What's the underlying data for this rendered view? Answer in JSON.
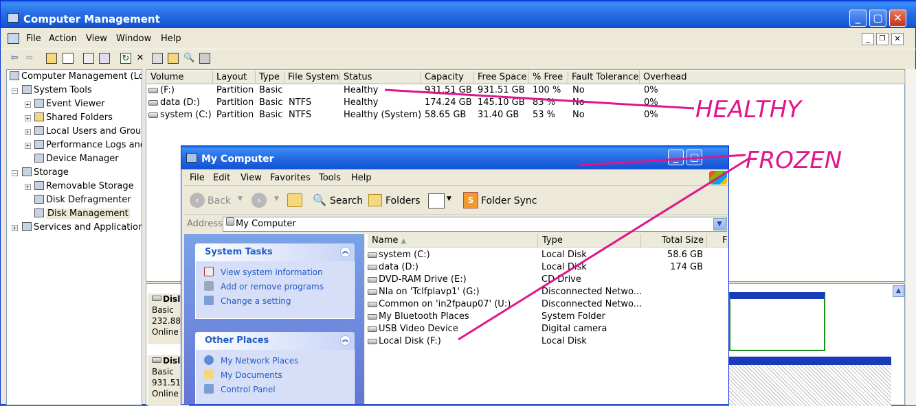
{
  "cm": {
    "title": "Computer Management",
    "menu": [
      "File",
      "Action",
      "View",
      "Window",
      "Help"
    ],
    "tree": [
      {
        "label": "Computer Management (Loc",
        "level": 0
      },
      {
        "label": "System Tools",
        "level": 1
      },
      {
        "label": "Event Viewer",
        "level": 2
      },
      {
        "label": "Shared Folders",
        "level": 2
      },
      {
        "label": "Local Users and Group",
        "level": 2
      },
      {
        "label": "Performance Logs and",
        "level": 2
      },
      {
        "label": "Device Manager",
        "level": 2
      },
      {
        "label": "Storage",
        "level": 1
      },
      {
        "label": "Removable Storage",
        "level": 2
      },
      {
        "label": "Disk Defragmenter",
        "level": 2
      },
      {
        "label": "Disk Management",
        "level": 2
      },
      {
        "label": "Services and Applications",
        "level": 1
      }
    ],
    "volume_headers": [
      "Volume",
      "Layout",
      "Type",
      "File System",
      "Status",
      "Capacity",
      "Free Space",
      "% Free",
      "Fault Tolerance",
      "Overhead"
    ],
    "volumes": [
      [
        "(F:)",
        "Partition",
        "Basic",
        "",
        "Healthy",
        "931.51 GB",
        "931.51 GB",
        "100 %",
        "No",
        "0%"
      ],
      [
        "data (D:)",
        "Partition",
        "Basic",
        "NTFS",
        "Healthy",
        "174.24 GB",
        "145.10 GB",
        "83 %",
        "No",
        "0%"
      ],
      [
        "system (C:)",
        "Partition",
        "Basic",
        "NTFS",
        "Healthy (System)",
        "58.65 GB",
        "31.40 GB",
        "53 %",
        "No",
        "0%"
      ]
    ],
    "disks": [
      {
        "name": "Disl",
        "type": "Basic",
        "size": "232.88",
        "state": "Online"
      },
      {
        "name": "Disl",
        "type": "Basic",
        "size": "931.51",
        "state": "Online"
      }
    ]
  },
  "mc": {
    "title": "My Computer",
    "menu": [
      "File",
      "Edit",
      "View",
      "Favorites",
      "Tools",
      "Help"
    ],
    "toolbar": {
      "back": "Back",
      "search": "Search",
      "folders": "Folders",
      "folder_sync": "Folder Sync"
    },
    "address_label": "Address",
    "address_value": "My Computer",
    "system_tasks": {
      "title": "System Tasks",
      "links": [
        "View system information",
        "Add or remove programs",
        "Change a setting"
      ]
    },
    "other_places": {
      "title": "Other Places",
      "links": [
        "My Network Places",
        "My Documents",
        "Control Panel"
      ]
    },
    "file_headers": [
      "Name",
      "Type",
      "Total Size",
      "F"
    ],
    "files": [
      {
        "name": "system (C:)",
        "type": "Local Disk",
        "size": "58.6 GB"
      },
      {
        "name": "data (D:)",
        "type": "Local Disk",
        "size": "174 GB"
      },
      {
        "name": "DVD-RAM Drive (E:)",
        "type": "CD Drive",
        "size": ""
      },
      {
        "name": "Nla on 'Tclfplavp1' (G:)",
        "type": "Disconnected Netwo...",
        "size": ""
      },
      {
        "name": "Common on 'in2fpaup07' (U:)",
        "type": "Disconnected Netwo...",
        "size": ""
      },
      {
        "name": "My Bluetooth Places",
        "type": "System Folder",
        "size": ""
      },
      {
        "name": "USB Video Device",
        "type": "Digital camera",
        "size": ""
      },
      {
        "name": "Local Disk (F:)",
        "type": "Local Disk",
        "size": ""
      }
    ]
  },
  "annotations": {
    "healthy": "HEALTHY",
    "frozen": "FROZEN"
  },
  "colors": {
    "annotation": "#e0158c",
    "xp_blue": "#0a5fe0",
    "link": "#215dc6"
  }
}
